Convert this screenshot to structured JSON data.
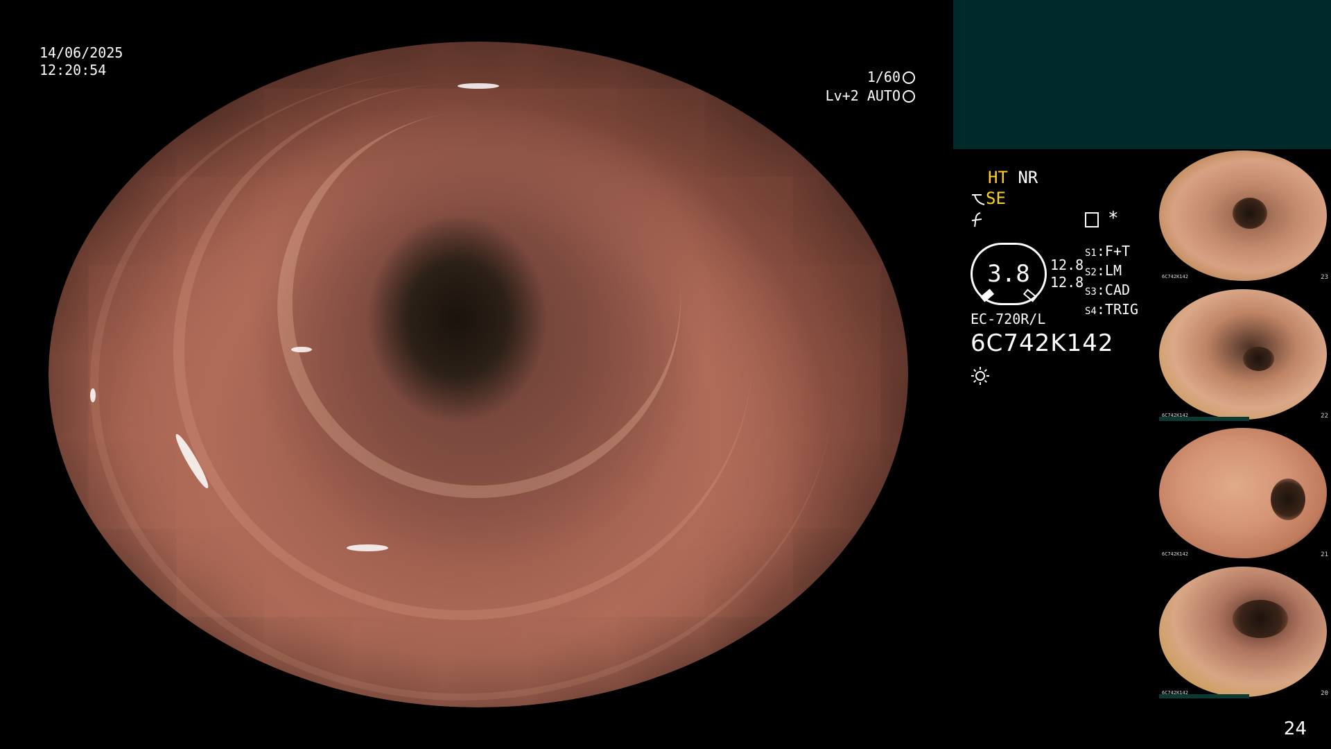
{
  "overlay": {
    "date": "14/06/2025",
    "time": "12:20:54",
    "shutter": "1/60",
    "exposure": "Lv+2 AUTO"
  },
  "panel": {
    "ht": "HT",
    "nr": "NR",
    "se": "SE",
    "gauge_value": "3.8",
    "side_value_1": "12.8",
    "side_value_2": "12.8",
    "slots": [
      {
        "key": "S1",
        "value": "F+T"
      },
      {
        "key": "S2",
        "value": "LM"
      },
      {
        "key": "S3",
        "value": "CAD"
      },
      {
        "key": "S4",
        "value": "TRIG"
      }
    ],
    "scope_model": "EC-720R/L",
    "serial": "6C742K142",
    "star": "*"
  },
  "thumbnails": [
    {
      "label": "23",
      "mini_serial": "6C742K142"
    },
    {
      "label": "22",
      "mini_serial": "6C742K142"
    },
    {
      "label": "21",
      "mini_serial": "6C742K142"
    },
    {
      "label": "20",
      "mini_serial": "6C742K142"
    }
  ],
  "page_number": "24",
  "colors": {
    "mode_accent": "#ffd21a",
    "teal_panel": "#002a2a"
  },
  "icons": [
    "shutter-icon",
    "auto-iris-icon",
    "structure-enhance-icon",
    "color-mode-icon",
    "memo-icon",
    "light-source-icon"
  ]
}
